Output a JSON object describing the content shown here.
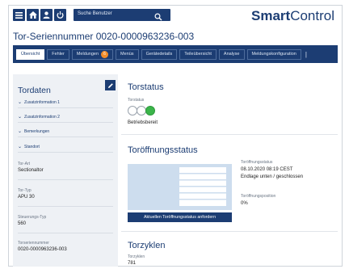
{
  "header": {
    "search_placeholder": "Suche Benutzer",
    "brand_bold": "Smart",
    "brand_regular": "Control",
    "icons": [
      "menu-icon",
      "home-icon",
      "user-icon",
      "power-icon",
      "search-icon"
    ]
  },
  "page_title": "Tor-Seriennummer 0020-0000963236-003",
  "tabs": [
    {
      "label": "Übersicht",
      "active": true
    },
    {
      "label": "Fehler"
    },
    {
      "label": "Meldungen",
      "badge": "6"
    },
    {
      "label": "Menüs"
    },
    {
      "label": "Gerätedetails"
    },
    {
      "label": "Teileübersicht"
    },
    {
      "label": "Analyse"
    },
    {
      "label": "Meldungskonfiguration"
    }
  ],
  "sidebar": {
    "title": "Tordaten",
    "accordions": [
      "Zusatzinformation 1",
      "Zusatzinformation 2",
      "Bemerkungen",
      "Standort"
    ],
    "fields": [
      {
        "label": "Tor-Art",
        "value": "Sectionaltor"
      },
      {
        "label": "Tor-Typ",
        "value": "APU 30"
      },
      {
        "label": "Steuerungs-Typ",
        "value": "560"
      },
      {
        "label": "Torseriennummer",
        "value": "0020-0000963236-003"
      }
    ]
  },
  "torstatus": {
    "heading": "Torstatus",
    "label": "Torstatus",
    "state": "Betriebsbereit"
  },
  "oeffnung": {
    "heading": "Toröffnungsstatus",
    "status_label": "Toröffnungsstatus",
    "status_datetime": "08.10.2020 08:19 CEST",
    "status_text": "Endlage unten / geschlossen",
    "position_label": "Toröffnungsposition",
    "position_value": "0%",
    "button_label": "Aktuellen Toröffnungsstatus anfordern"
  },
  "zyklen": {
    "heading": "Torzyklen",
    "label": "Torzyklen",
    "value": "781"
  },
  "colors": {
    "brand_navy": "#1c3d73",
    "status_green": "#3bb54a",
    "badge_orange": "#f28c28",
    "door_fill": "#cdddee"
  }
}
